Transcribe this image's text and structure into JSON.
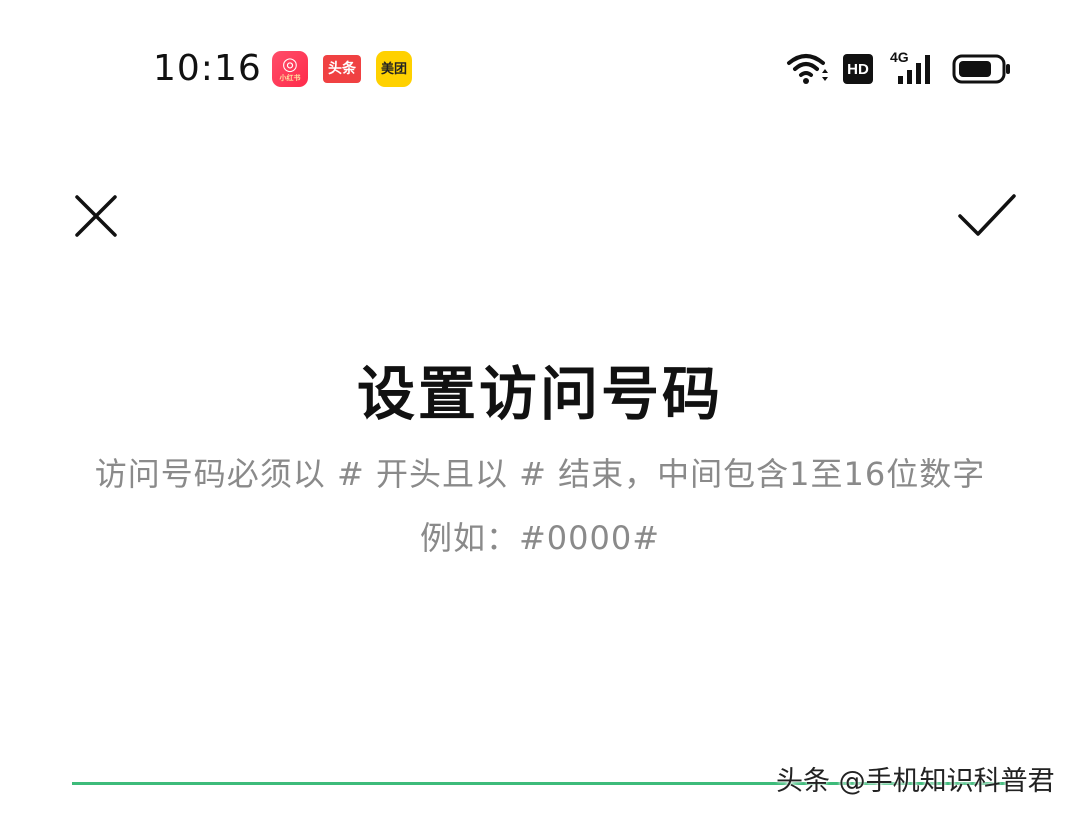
{
  "status_bar": {
    "time": "10:16",
    "notification_apps": [
      {
        "name": "xiaohongshu-icon",
        "label": "小红书",
        "glyph": "◎",
        "sub": "小红书",
        "color": "#ff2a4a"
      },
      {
        "name": "toutiao-icon",
        "label": "头条",
        "color": "#f04142"
      },
      {
        "name": "meituan-icon",
        "label": "美团",
        "color": "#ffd100"
      }
    ],
    "hd_badge": "HD",
    "network_type": "4G",
    "icons": [
      "wifi-icon",
      "hd-icon",
      "cellular-signal-icon",
      "battery-icon"
    ]
  },
  "toolbar": {
    "close_icon": "close-icon",
    "confirm_icon": "check-icon"
  },
  "main": {
    "title": "设置访问号码",
    "hint_line1": "访问号码必须以 # 开头且以 # 结束，中间包含1至16位数字",
    "hint_line2": "例如：#0000#"
  },
  "input": {
    "value": "",
    "underline_color": "#3dbb7a"
  },
  "watermark": "头条 @手机知识科普君"
}
